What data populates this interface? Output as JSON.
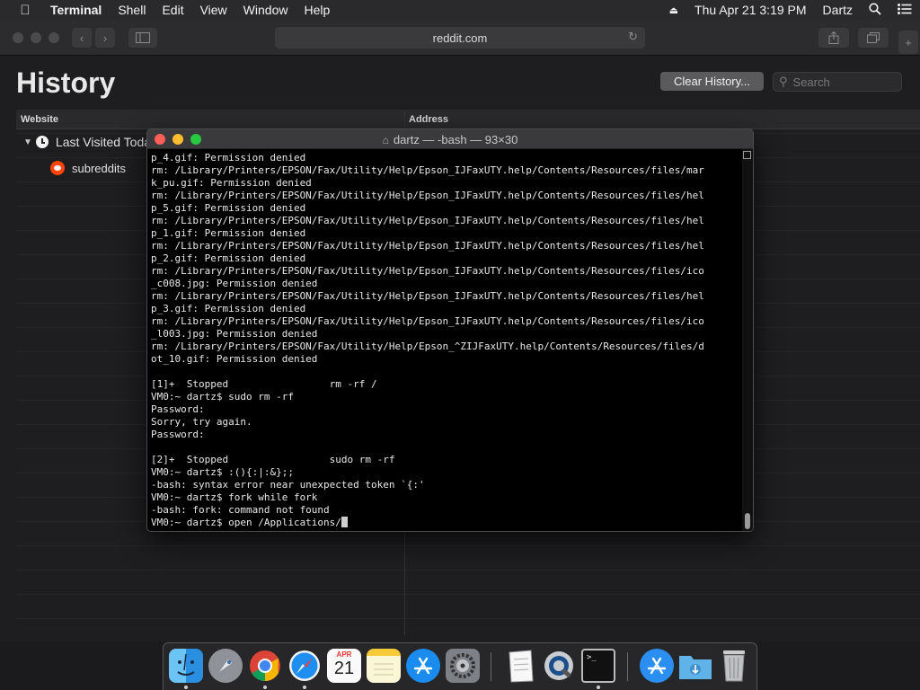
{
  "menubar": {
    "app_name": "Terminal",
    "items": [
      "Shell",
      "Edit",
      "View",
      "Window",
      "Help"
    ],
    "datetime": "Thu Apr 21  3:19 PM",
    "user": "Dartz"
  },
  "safari": {
    "url": "reddit.com",
    "page_title": "History",
    "clear_button": "Clear History...",
    "search_placeholder": "Search",
    "columns": {
      "website": "Website",
      "address": "Address"
    },
    "day_group": "Last Visited Toda",
    "site_entry": "subreddits"
  },
  "terminal": {
    "title": "dartz — -bash — 93×30",
    "lines": [
      "p_4.gif: Permission denied",
      "rm: /Library/Printers/EPSON/Fax/Utility/Help/Epson_IJFaxUTY.help/Contents/Resources/files/mar",
      "k_pu.gif: Permission denied",
      "rm: /Library/Printers/EPSON/Fax/Utility/Help/Epson_IJFaxUTY.help/Contents/Resources/files/hel",
      "p_5.gif: Permission denied",
      "rm: /Library/Printers/EPSON/Fax/Utility/Help/Epson_IJFaxUTY.help/Contents/Resources/files/hel",
      "p_1.gif: Permission denied",
      "rm: /Library/Printers/EPSON/Fax/Utility/Help/Epson_IJFaxUTY.help/Contents/Resources/files/hel",
      "p_2.gif: Permission denied",
      "rm: /Library/Printers/EPSON/Fax/Utility/Help/Epson_IJFaxUTY.help/Contents/Resources/files/ico",
      "_c008.jpg: Permission denied",
      "rm: /Library/Printers/EPSON/Fax/Utility/Help/Epson_IJFaxUTY.help/Contents/Resources/files/hel",
      "p_3.gif: Permission denied",
      "rm: /Library/Printers/EPSON/Fax/Utility/Help/Epson_IJFaxUTY.help/Contents/Resources/files/ico",
      "_l003.jpg: Permission denied",
      "rm: /Library/Printers/EPSON/Fax/Utility/Help/Epson_^ZIJFaxUTY.help/Contents/Resources/files/d",
      "ot_10.gif: Permission denied",
      "",
      "[1]+  Stopped                 rm -rf /",
      "VM0:~ dartz$ sudo rm -rf",
      "Password:",
      "Sorry, try again.",
      "Password:",
      "",
      "[2]+  Stopped                 sudo rm -rf",
      "VM0:~ dartz$ :(){:|:&};;",
      "-bash: syntax error near unexpected token `{:'",
      "VM0:~ dartz$ fork while fork",
      "-bash: fork: command not found"
    ],
    "prompt_line": "VM0:~ dartz$ open /Applications/"
  },
  "dock": {
    "apps": [
      "finder-icon",
      "launchpad-icon",
      "chrome-icon",
      "safari-icon",
      "calendar-icon",
      "notes-icon",
      "app-store-icon",
      "system-preferences-icon",
      "textedit-icon",
      "quicktime-icon",
      "terminal-icon",
      "applications-folder-icon",
      "downloads-folder-icon",
      "trash-icon"
    ],
    "calendar_month": "APR",
    "calendar_day": "21"
  }
}
